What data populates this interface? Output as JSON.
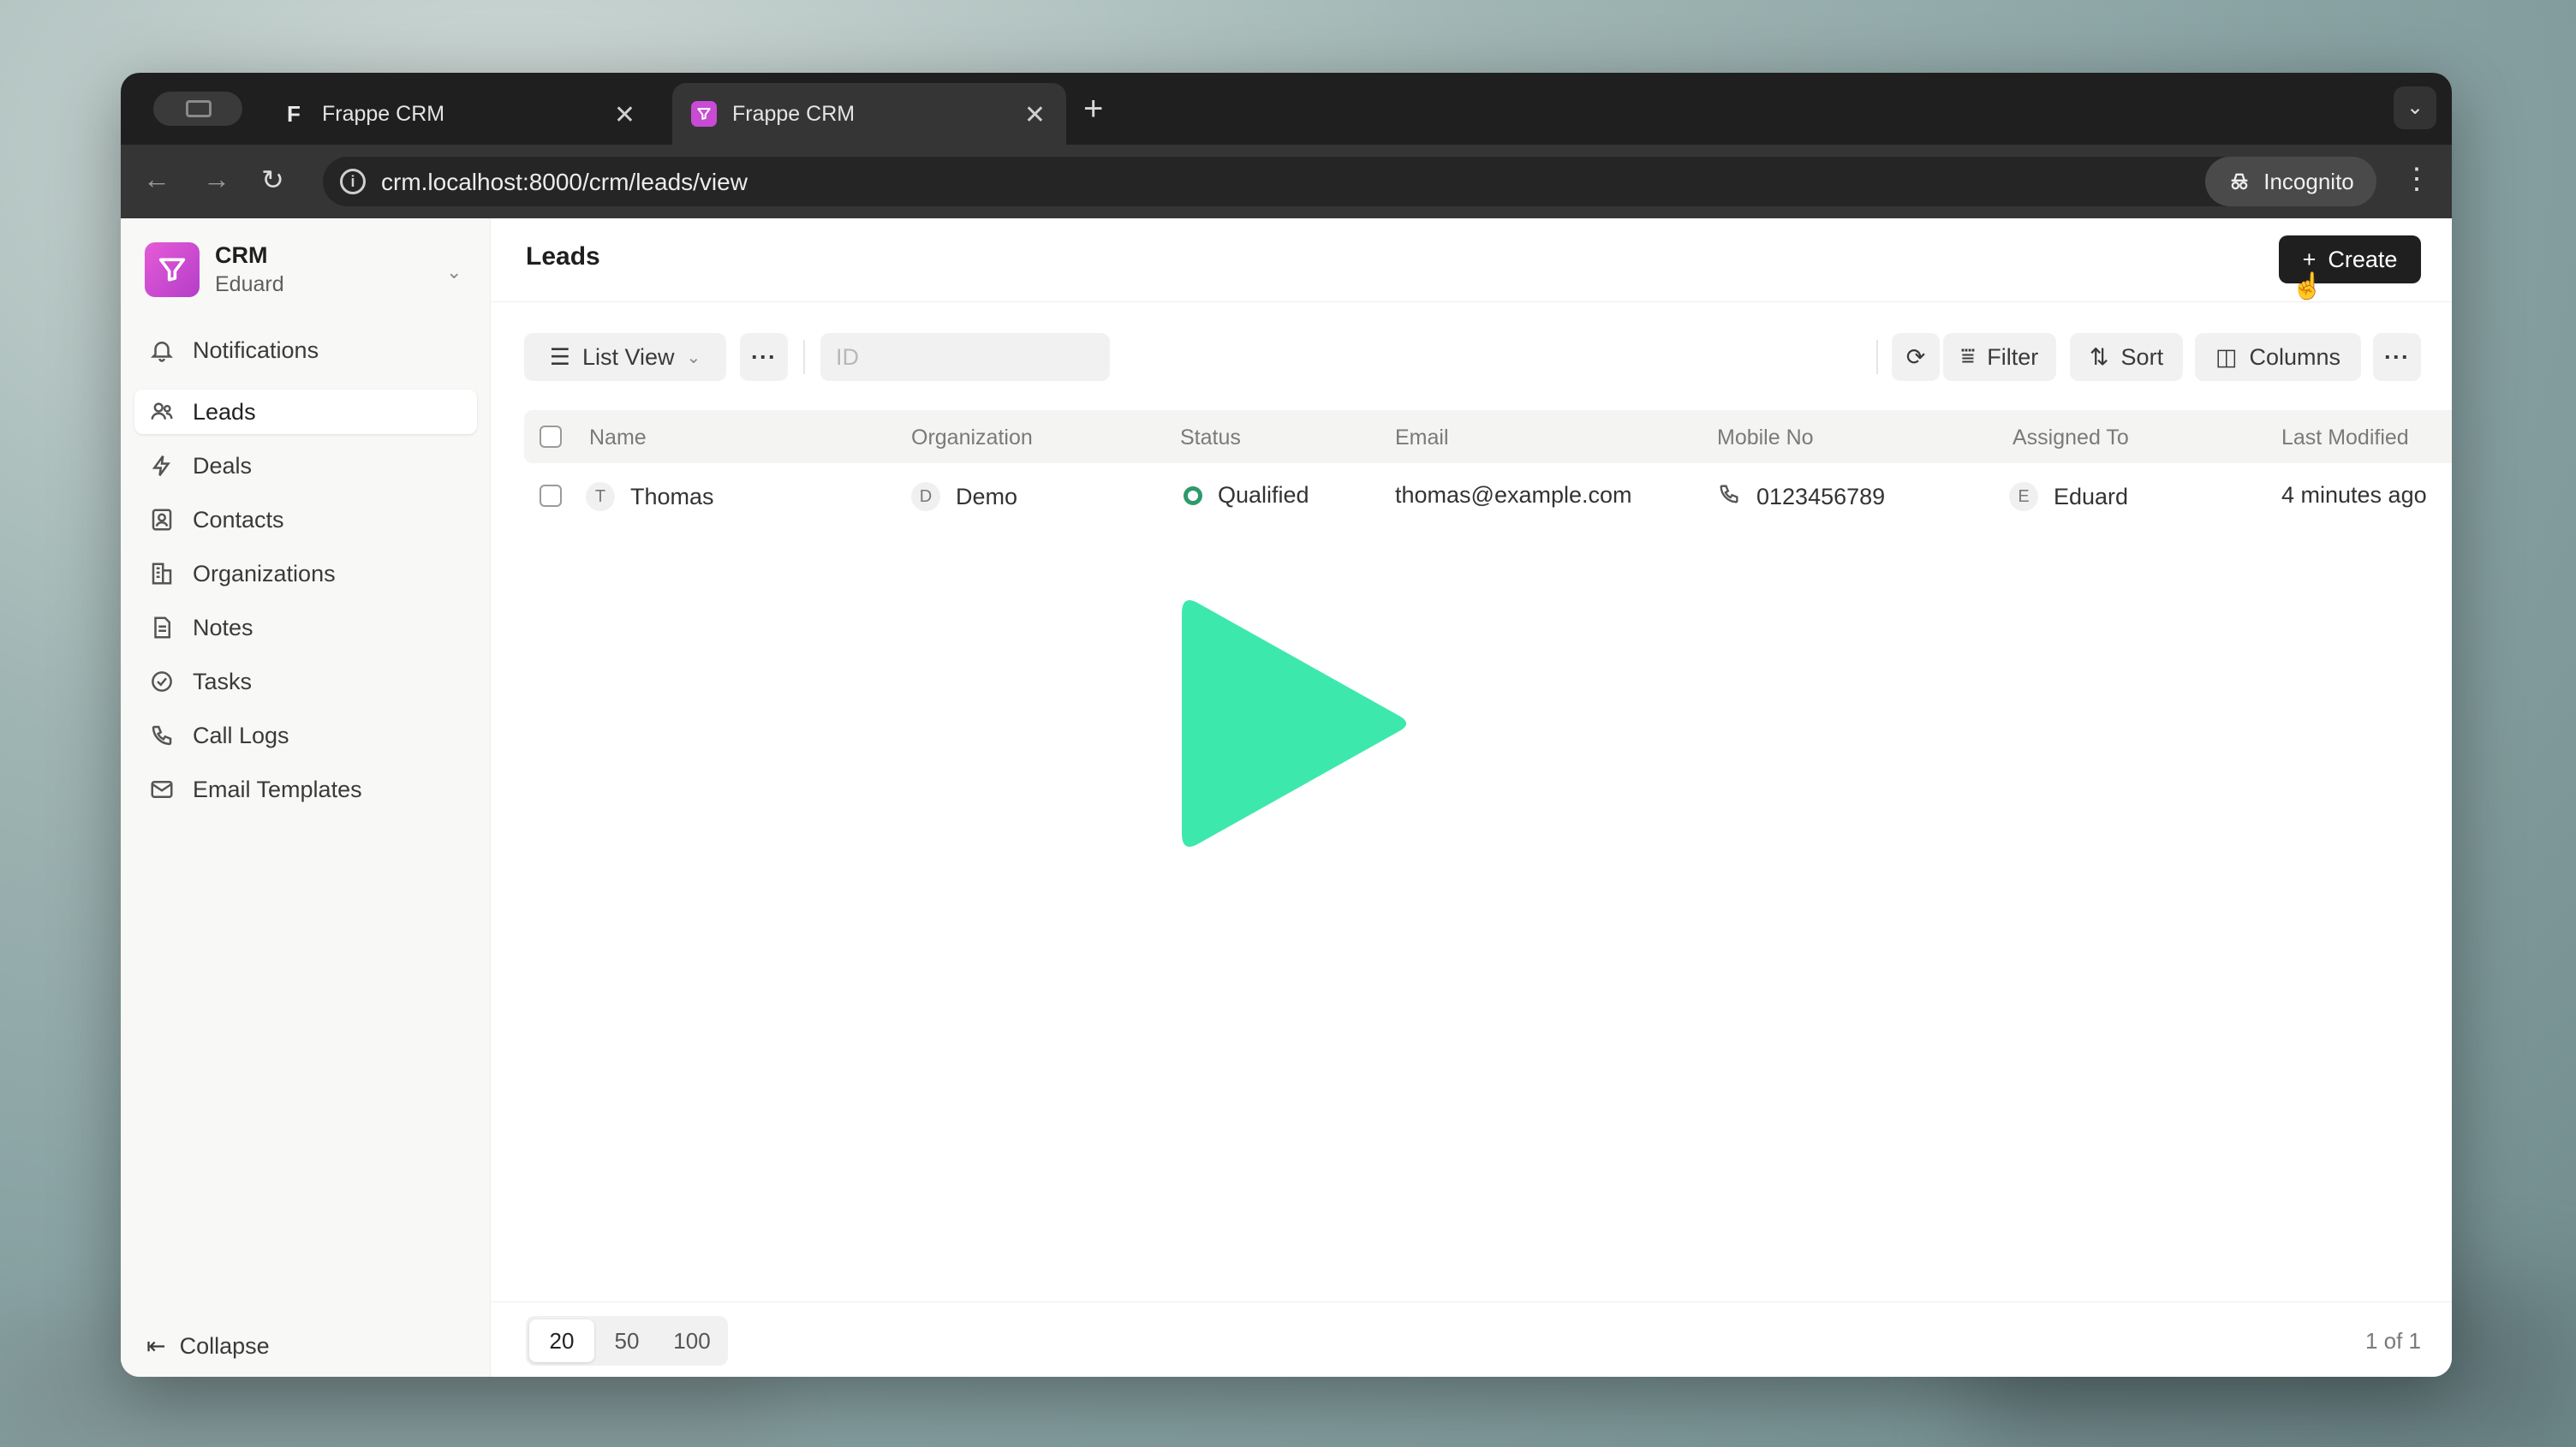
{
  "browser": {
    "tabs": [
      {
        "title": "Frappe CRM",
        "favicon": "frappe-f-icon"
      },
      {
        "title": "Frappe CRM",
        "favicon": "crm-logo-icon",
        "active": true
      }
    ],
    "url": "crm.localhost:8000/crm/leads/view",
    "incognito_label": "Incognito"
  },
  "sidebar": {
    "brand": {
      "name": "CRM",
      "user": "Eduard"
    },
    "items": [
      {
        "label": "Notifications",
        "icon": "bell-icon"
      },
      {
        "label": "Leads",
        "icon": "users-icon",
        "active": true
      },
      {
        "label": "Deals",
        "icon": "lightning-icon"
      },
      {
        "label": "Contacts",
        "icon": "contact-card-icon"
      },
      {
        "label": "Organizations",
        "icon": "building-icon"
      },
      {
        "label": "Notes",
        "icon": "note-icon"
      },
      {
        "label": "Tasks",
        "icon": "check-circle-icon"
      },
      {
        "label": "Call Logs",
        "icon": "phone-icon"
      },
      {
        "label": "Email Templates",
        "icon": "mail-icon"
      }
    ],
    "collapse_label": "Collapse"
  },
  "header": {
    "title": "Leads",
    "create_label": "Create"
  },
  "toolbar": {
    "view_label": "List View",
    "id_placeholder": "ID",
    "filter_label": "Filter",
    "sort_label": "Sort",
    "columns_label": "Columns"
  },
  "table": {
    "columns": [
      "Name",
      "Organization",
      "Status",
      "Email",
      "Mobile No",
      "Assigned To",
      "Last Modified"
    ],
    "rows": [
      {
        "name_initial": "T",
        "name": "Thomas",
        "org_initial": "D",
        "organization": "Demo",
        "status": "Qualified",
        "email": "thomas@example.com",
        "mobile": "0123456789",
        "assigned_initial": "E",
        "assigned_to": "Eduard",
        "last_modified": "4 minutes ago"
      }
    ]
  },
  "pagination": {
    "sizes": [
      "20",
      "50",
      "100"
    ],
    "active": "20",
    "count_text": "1 of 1"
  },
  "colors": {
    "accent": "#c84bd4",
    "status_qualified": "#2e9a6a",
    "play_overlay": "#3de8ad",
    "primary_button": "#1f1f1f"
  }
}
